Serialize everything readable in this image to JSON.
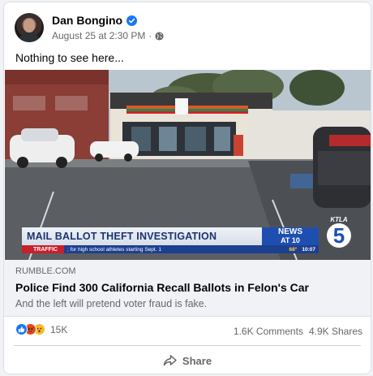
{
  "post": {
    "author": "Dan Bongino",
    "timestamp": "August 25 at 2:30 PM",
    "separator": "·",
    "caption": "Nothing to see here...",
    "icons": {
      "verified": "verified-badge-icon",
      "audience": "globe-icon",
      "share": "share-arrow-icon"
    }
  },
  "media": {
    "chyron_headline": "MAIL BALLOT THEFT INVESTIGATION",
    "news_line1": "NEWS",
    "news_line2": "AT 10",
    "station": "KTLA",
    "channel": "5",
    "ticker_label": "TRAFFIC",
    "ticker_text": "; for high school athletes starting Sept. 1",
    "ticker_temp": "68°",
    "ticker_time": "10:07"
  },
  "link": {
    "domain": "RUMBLE.COM",
    "headline": "Police Find 300 California Recall Ballots in Felon's Car",
    "description": "And the left will pretend voter fraud is fake."
  },
  "engagement": {
    "reaction_count": "15K",
    "comments": "1.6K Comments",
    "shares": "4.9K Shares",
    "reactions": [
      "like",
      "angry",
      "wow"
    ]
  },
  "actions": {
    "share_label": "Share"
  },
  "colors": {
    "brand_blue": "#1877f2",
    "secondary_text": "#65676b",
    "link_bg": "#f0f2f5"
  }
}
